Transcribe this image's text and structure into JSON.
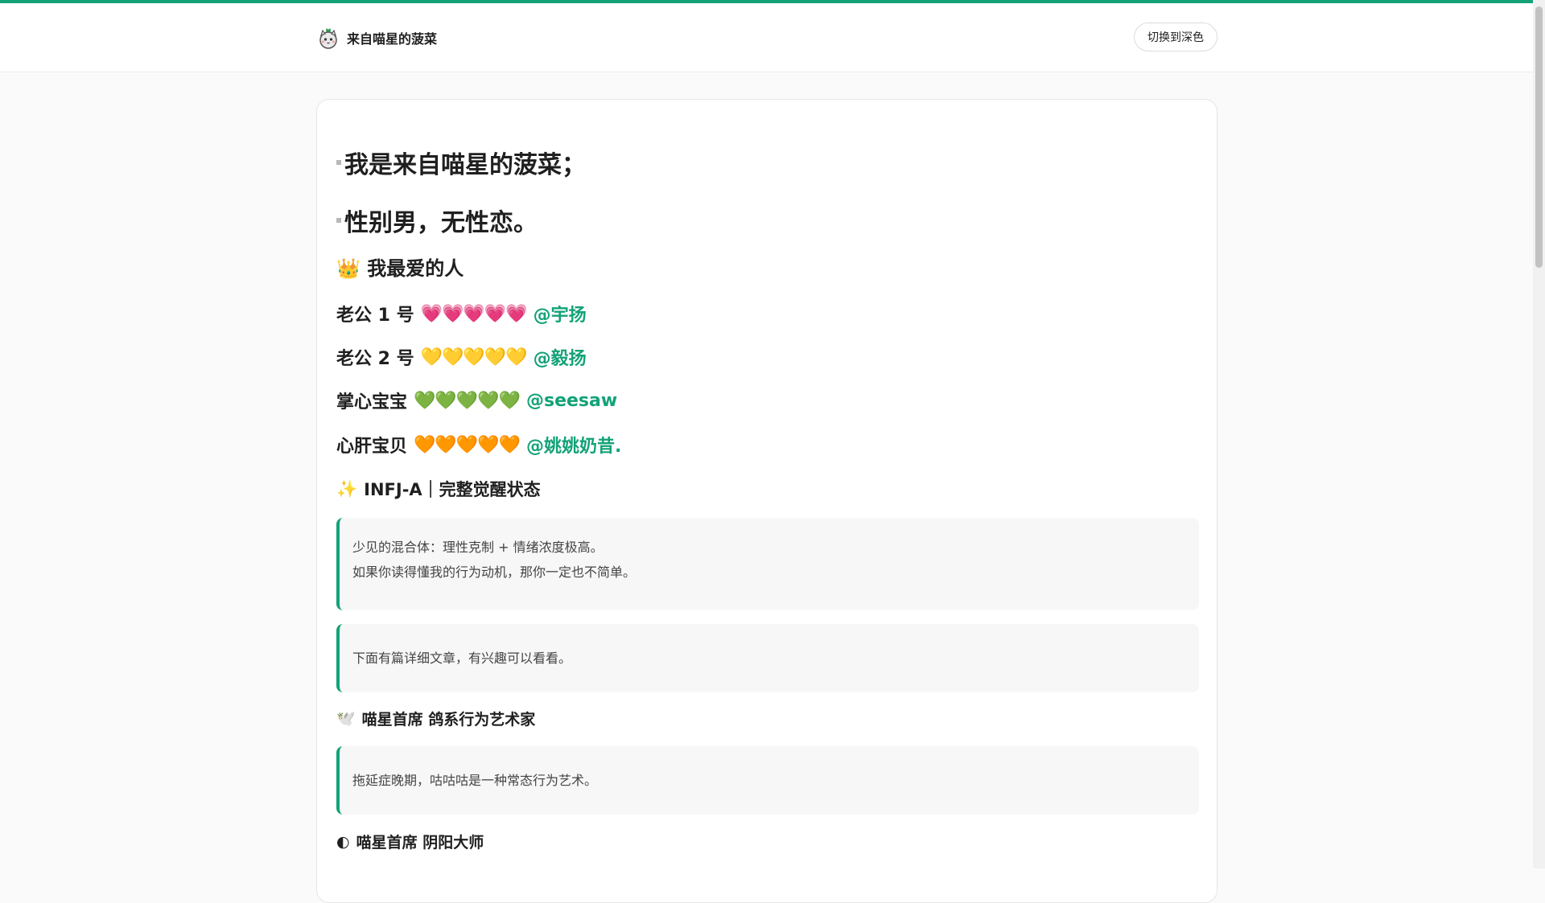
{
  "header": {
    "site_title": "来自喵星的菠菜",
    "theme_toggle_label": "切换到深色",
    "logo_icon": "cat-spinach-avatar-icon"
  },
  "intro": {
    "line1": "我是来自喵星的菠菜；",
    "line2": "性别男，无性恋。"
  },
  "favorites": {
    "title_icon": "👑",
    "title": "我最爱的人",
    "people": [
      {
        "label": "老公 1 号",
        "hearts": "💗💗💗💗💗",
        "handle": "@宇扬"
      },
      {
        "label": "老公 2 号",
        "hearts": "💛💛💛💛💛",
        "handle": "@毅扬"
      },
      {
        "label": "掌心宝宝",
        "hearts": "💚💚💚💚💚",
        "handle": "@seesaw"
      },
      {
        "label": "心肝宝贝",
        "hearts": "🧡🧡🧡🧡🧡",
        "handle": "@姚姚奶昔."
      }
    ]
  },
  "mbti": {
    "icon": "✨",
    "title": "INFJ-A｜完整觉醒状态",
    "quote_line1": "少见的混合体：理性克制 + 情绪浓度极高。",
    "quote_line2": "如果你读得懂我的行为动机，那你一定也不简单。",
    "quote2": "下面有篇详细文章，有兴趣可以看看。"
  },
  "artist": {
    "icon": "🕊️",
    "title": "喵星首席 鸽系行为艺术家",
    "quote": "拖延症晚期，咕咕咕是一种常态行为艺术。"
  },
  "yinyang": {
    "icon": "◐",
    "title": "喵星首席 阴阳大师"
  },
  "colors": {
    "accent": "#13a277"
  }
}
